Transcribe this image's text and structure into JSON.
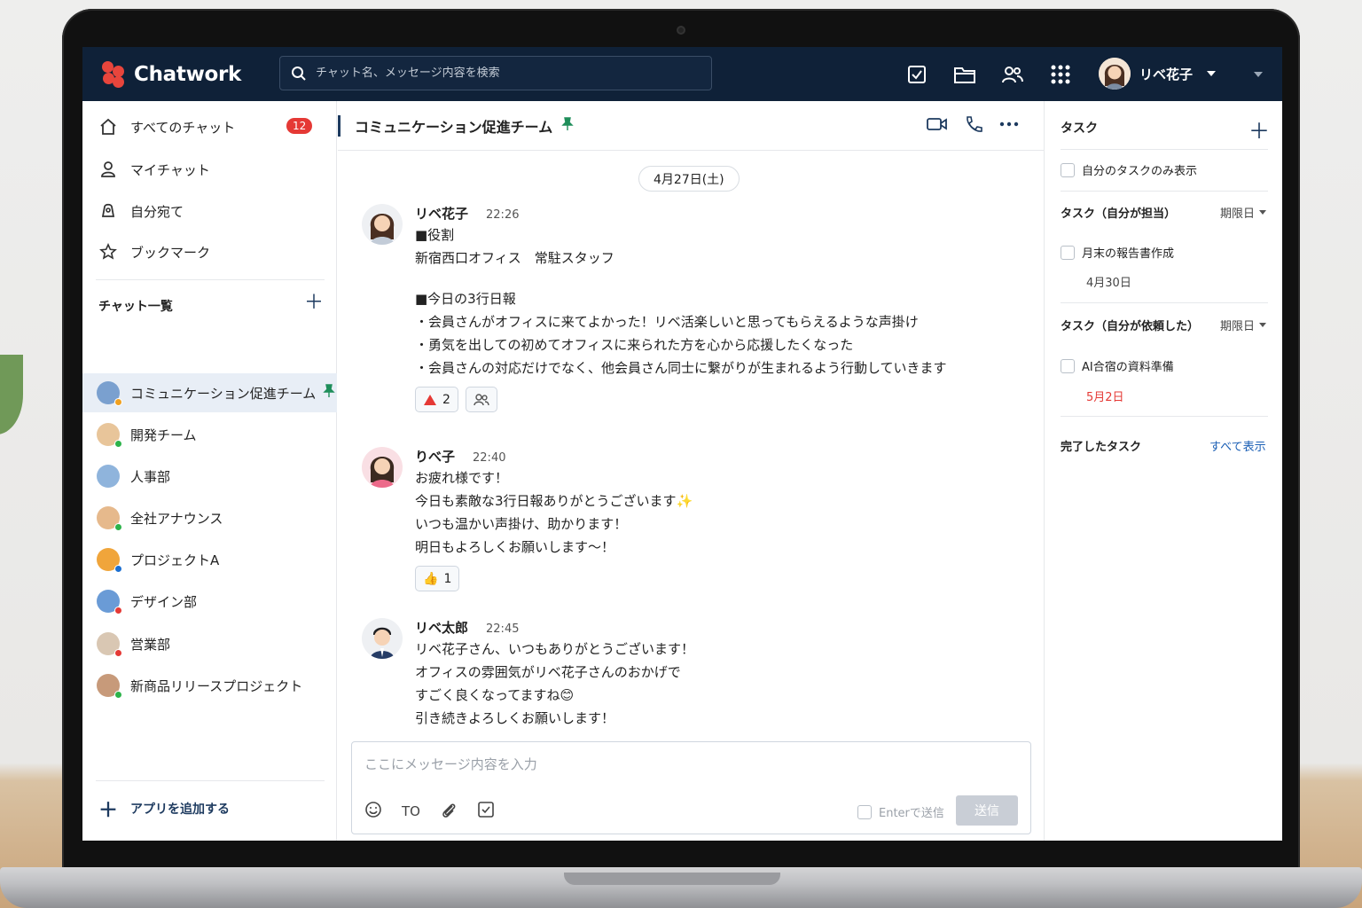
{
  "header": {
    "logo_text": "Chatwork",
    "search_placeholder": "チャット名、メッセージ内容を検索",
    "icons": [
      "task-icon",
      "folder-icon",
      "contacts-icon",
      "apps-grid-icon"
    ],
    "user_name": "リベ花子"
  },
  "sidebar": {
    "nav": [
      {
        "label": "すべてのチャット",
        "icon": "home-icon",
        "badge": "12"
      },
      {
        "label": "マイチャット",
        "icon": "person-icon"
      },
      {
        "label": "自分宛て",
        "icon": "mention-icon"
      },
      {
        "label": "ブックマーク",
        "icon": "star-icon"
      }
    ],
    "section_title": "チャット一覧",
    "rooms": [
      {
        "label": "コミュニケーション促進チーム",
        "active": true,
        "pinned": true
      },
      {
        "label": "開発チーム"
      },
      {
        "label": "人事部"
      },
      {
        "label": "全社アナウンス"
      },
      {
        "label": "プロジェクトA"
      },
      {
        "label": "デザイン部"
      },
      {
        "label": "営業部"
      },
      {
        "label": "新商品リリースプロジェクト"
      }
    ],
    "add_app_label": "アプリを追加する"
  },
  "chat": {
    "title": "コミュニケーション促進チーム",
    "date": "4月27日(土)",
    "messages": [
      {
        "name": "リベ花子",
        "time": "22:26",
        "lines": [
          "■役割",
          "新宿西口オフィス　常駐スタッフ",
          "",
          "■今日の3行日報",
          "・会員さんがオフィスに来てよかった！リベ活楽しいと思ってもらえるような声掛け",
          "・勇気を出しての初めてオフィスに来られた方を心から応援したくなった",
          "・会員さんの対応だけでなく、他会員さん同士に繋がりが生まれるよう行動していきます"
        ],
        "reaction_count": "2"
      },
      {
        "name": "りべ子",
        "time": "22:40",
        "lines": [
          "お疲れ様です！",
          "今日も素敵な3行日報ありがとうございます✨",
          "いつも温かい声掛け、助かります！",
          "明日もよろしくお願いします〜！"
        ],
        "reaction_count": "1"
      },
      {
        "name": "リベ太郎",
        "time": "22:45",
        "lines": [
          "リベ花子さん、いつもありがとうございます！",
          "オフィスの雰囲気がリベ花子さんのおかげで",
          "すごく良くなってますね😊",
          "引き続きよろしくお願いします！"
        ]
      }
    ],
    "composer": {
      "placeholder": "ここにメッセージ内容を入力",
      "to_label": "TO",
      "enter_label": "Enterで送信",
      "send_label": "送信"
    }
  },
  "tasks": {
    "title": "タスク",
    "only_mine": "自分のタスクのみ表示",
    "assigned_title": "タスク（自分が担当）",
    "sort_label": "期限日",
    "assigned": [
      {
        "label": "月末の報告書作成",
        "date": "4月30日"
      }
    ],
    "requested_title": "タスク（自分が依頼した）",
    "requested": [
      {
        "label": "AI合宿の資料準備",
        "date": "5月2日"
      }
    ],
    "done_title": "完了したタスク",
    "show_all": "すべて表示"
  },
  "colors": {
    "header": "#0f2138",
    "accent": "#e53935",
    "link": "#1b5fb5"
  }
}
